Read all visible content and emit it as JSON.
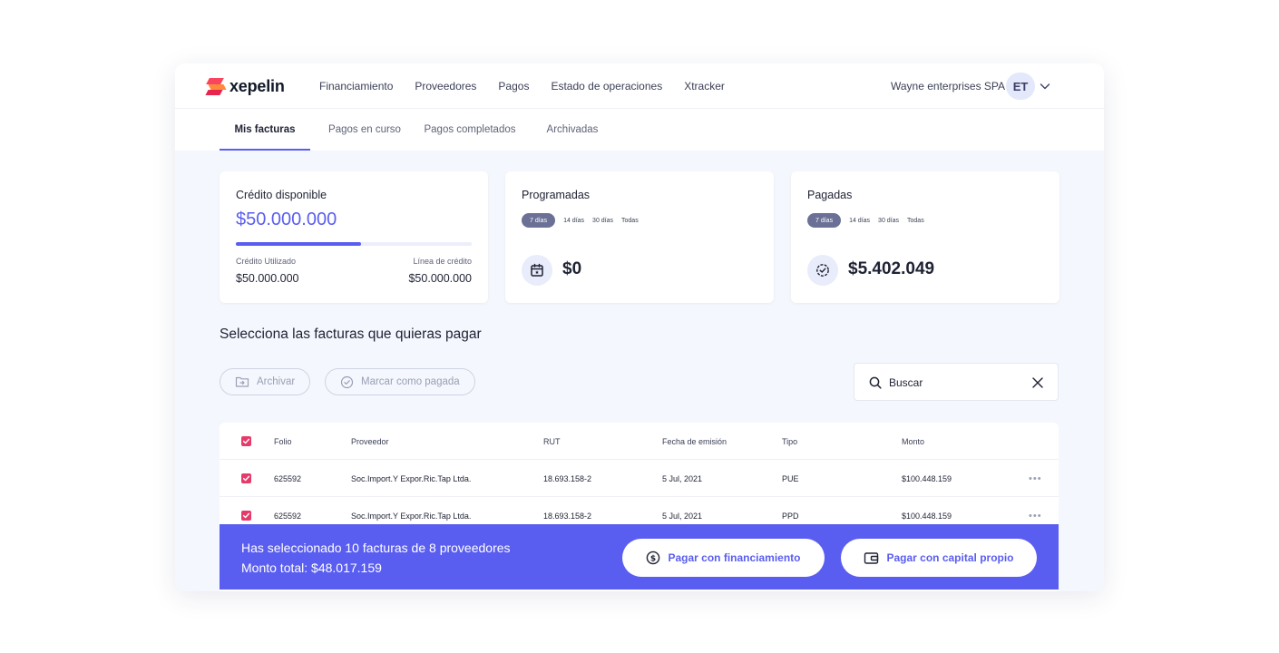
{
  "brand": {
    "name": "xepelin",
    "accent": "#5a5ef0"
  },
  "nav": {
    "links": [
      "Financiamiento",
      "Proveedores",
      "Pagos",
      "Estado de operaciones",
      "Xtracker"
    ],
    "company": "Wayne enterprises SPA",
    "avatar_initials": "ET"
  },
  "tabs": [
    {
      "label": "Mis facturas",
      "active": true
    },
    {
      "label": "Pagos en curso",
      "active": false
    },
    {
      "label": "Pagos completados",
      "active": false
    },
    {
      "label": "Archivadas",
      "active": false
    }
  ],
  "credit": {
    "title": "Crédito disponible",
    "value": "$50.000.000",
    "used_label": "Crédito Utilizado",
    "used_value": "$50.000.000",
    "line_label": "Línea de crédito",
    "line_value": "$50.000.000"
  },
  "programadas": {
    "title": "Programadas",
    "filters": [
      "7 días",
      "14 días",
      "30 días",
      "Todas"
    ],
    "value": "$0",
    "icon": "calendar-icon"
  },
  "pagadas": {
    "title": "Pagadas",
    "filters": [
      "7 días",
      "14 días",
      "30 días",
      "Todas"
    ],
    "value": "$5.402.049",
    "icon": "check-circle-icon"
  },
  "section_title": "Selecciona las facturas que quieras pagar",
  "actions": {
    "archive": "Archivar",
    "mark_paid": "Marcar como pagada"
  },
  "search": {
    "placeholder": "Buscar"
  },
  "table": {
    "columns": [
      "Folio",
      "Proveedor",
      "RUT",
      "Fecha de emisión",
      "Tipo",
      "Monto"
    ],
    "rows": [
      {
        "folio": "625592",
        "proveedor": "Soc.Import.Y Expor.Ric.Tap Ltda.",
        "rut": "18.693.158-2",
        "fecha": "5 Jul, 2021",
        "tipo": "PUE",
        "monto": "$100.448.159"
      },
      {
        "folio": "625592",
        "proveedor": "Soc.Import.Y Expor.Ric.Tap Ltda.",
        "rut": "18.693.158-2",
        "fecha": "5 Jul, 2021",
        "tipo": "PPD",
        "monto": "$100.448.159"
      }
    ]
  },
  "selection": {
    "summary": "Has seleccionado 10 facturas de 8 proveedores",
    "total": "Monto total: $48.017.159",
    "pay_financing": "Pagar con financiamiento",
    "pay_own": "Pagar con capital propio"
  }
}
